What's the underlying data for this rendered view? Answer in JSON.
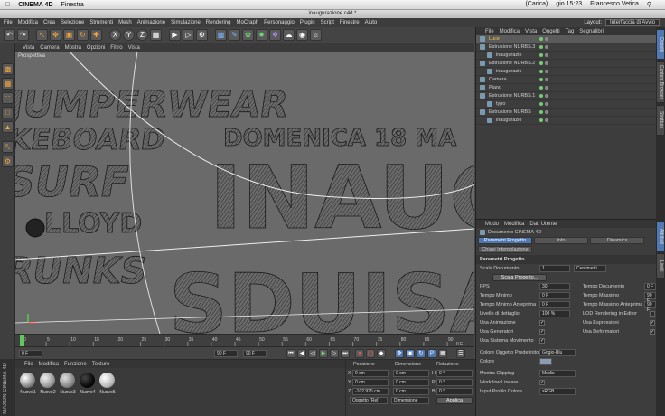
{
  "os": {
    "app_name": "CINEMA 4D",
    "menu": [
      "Finestra"
    ],
    "status": [
      "(Carica)"
    ],
    "clock": "gio 15:23",
    "user": "Francesco Vetica"
  },
  "window": {
    "title": "inaugurazione.c4d *"
  },
  "menubar": {
    "items": [
      "File",
      "Modifica",
      "Crea",
      "Selezione",
      "Strumenti",
      "Mesh",
      "Animazione",
      "Simulazione",
      "Rendering",
      "MoCraph",
      "Personaggio",
      "Plugin",
      "Script",
      "Finestre",
      "Aiuto"
    ],
    "layout_label": "Layout:",
    "layout_value": "Interfaccia di Avvio"
  },
  "toolbar": {
    "axis": [
      "X",
      "Y",
      "Z"
    ]
  },
  "viewport": {
    "menu": [
      "Vista",
      "Camera",
      "Mostra",
      "Opzioni",
      "Filtro",
      "Vista"
    ],
    "label": "Prospettiva",
    "scene_texts": {
      "t1": "JUMPERWEAR",
      "t2": "KEBOARD",
      "t3": "SURF",
      "t4": "LLOYD",
      "t5": "TRUNKS",
      "t6": "DOMENICA 18 MA",
      "t7": "INAUG",
      "t8": "SDUISA"
    }
  },
  "timeline": {
    "ticks": [
      "0",
      "5",
      "10",
      "15",
      "20",
      "25",
      "30",
      "35",
      "40",
      "45",
      "50",
      "55",
      "60",
      "65",
      "70",
      "75",
      "80",
      "85",
      "90"
    ],
    "end_label": "0 F",
    "start_field": "0 F",
    "end_field1": "90 F",
    "end_field2": "90 F"
  },
  "materials": {
    "menu": [
      "File",
      "Modifica",
      "Funzione",
      "Texture"
    ],
    "items": [
      "Nuovo1",
      "Nuovo2",
      "Nuovo3",
      "Nuovo4",
      "Nuovo5"
    ],
    "brand": "MAXON CINEMA 4D"
  },
  "coords": {
    "headers": [
      "Posizione",
      "Dimensione",
      "Rotazione"
    ],
    "rows": [
      {
        "axis": "X",
        "pos": "0 cm",
        "dim": "0 cm",
        "rotlbl": "H",
        "rot": "0 °"
      },
      {
        "axis": "Y",
        "pos": "0 cm",
        "dim": "0 cm",
        "rotlbl": "P",
        "rot": "0 °"
      },
      {
        "axis": "Z",
        "pos": "-102.925 cm",
        "dim": "0 cm",
        "rotlbl": "B",
        "rot": "0 °"
      }
    ],
    "mode1": "Oggetto (Rel)",
    "mode2": "Dimensione",
    "apply": "Applica"
  },
  "objects": {
    "menu": [
      "File",
      "Modifica",
      "Vista",
      "Oggetti",
      "Tag",
      "Segnalibri"
    ],
    "rows": [
      {
        "name": "Luce",
        "indent": 0,
        "hl": true,
        "sel": true
      },
      {
        "name": "Estrusione NURBS.3",
        "indent": 0,
        "hl": false,
        "sel": false
      },
      {
        "name": "inaugurazio",
        "indent": 1,
        "hl": false,
        "sel": false
      },
      {
        "name": "Estrusione NURBS.2",
        "indent": 0,
        "hl": false,
        "sel": false
      },
      {
        "name": "inaugurazio",
        "indent": 1,
        "hl": false,
        "sel": false
      },
      {
        "name": "Camera",
        "indent": 0,
        "hl": false,
        "sel": false
      },
      {
        "name": "Piano",
        "indent": 0,
        "hl": false,
        "sel": false
      },
      {
        "name": "Estrusione NURBS.1",
        "indent": 0,
        "hl": false,
        "sel": false
      },
      {
        "name": "typo",
        "indent": 1,
        "hl": false,
        "sel": false
      },
      {
        "name": "Estrusione NURBS",
        "indent": 0,
        "hl": false,
        "sel": false
      },
      {
        "name": "inaugurazio",
        "indent": 1,
        "hl": false,
        "sel": false
      }
    ]
  },
  "attributes": {
    "menu": [
      "Modo",
      "Modifica",
      "Dati Utente"
    ],
    "doc_title": "Documento CINEMA 4D",
    "tabs": [
      "Parametri Progetto",
      "Info",
      "Dinamics"
    ],
    "subtab": "Chiavi Interpolazione",
    "section": "Parametri Progetto",
    "scala_label": "Scala Documento",
    "scala_value": "1",
    "scala_unit": "Centimetri",
    "scala_button": "Scala Progetto...",
    "fps_label": "FPS",
    "fps_value": "30",
    "tempo_doc_label": "Tempo Documento",
    "tempo_doc_value": "0 F",
    "tempo_min_label": "Tempo Minimo",
    "tempo_min_value": "0 F",
    "tempo_max_label": "Tempo Massimo",
    "tempo_max_value": "90 F",
    "tempo_min_ant_label": "Tempo Minimo Anteprima",
    "tempo_min_ant_value": "0 F",
    "tempo_max_ant_label": "Tempo Massimo Anteprima",
    "tempo_max_ant_value": "90 F",
    "livello_label": "Livello di dettaglio",
    "livello_value": "100 %",
    "lod_label": "LOD Rendering in Editor",
    "usa_anim": "Usa Animazione",
    "usa_espr": "Usa Espressioni",
    "usa_gen": "Usa Generatori",
    "usa_def": "Usa Deformatori",
    "usa_sist": "Usa Sistema Movimento",
    "colore_pred_label": "Colore Oggetto Predefinito",
    "colore_pred_value": "Grigio-Blu",
    "colore_label": "Colore",
    "clipping_label": "Mostra Clipping",
    "clipping_value": "Medio",
    "workflow_label": "Workflow Lineare",
    "input_label": "Input Profilo Colore",
    "input_value": "sRGB"
  },
  "righttabs": [
    "Oggetti",
    "Content Browser",
    "Struttura",
    "Attributi",
    "Livelli"
  ],
  "colors": {
    "accent_blue": "#4f79b4",
    "highlight_yellow": "#f3c73a",
    "icon_orange": "#f4a43a",
    "viewport_bg": "#6a6a6a"
  }
}
